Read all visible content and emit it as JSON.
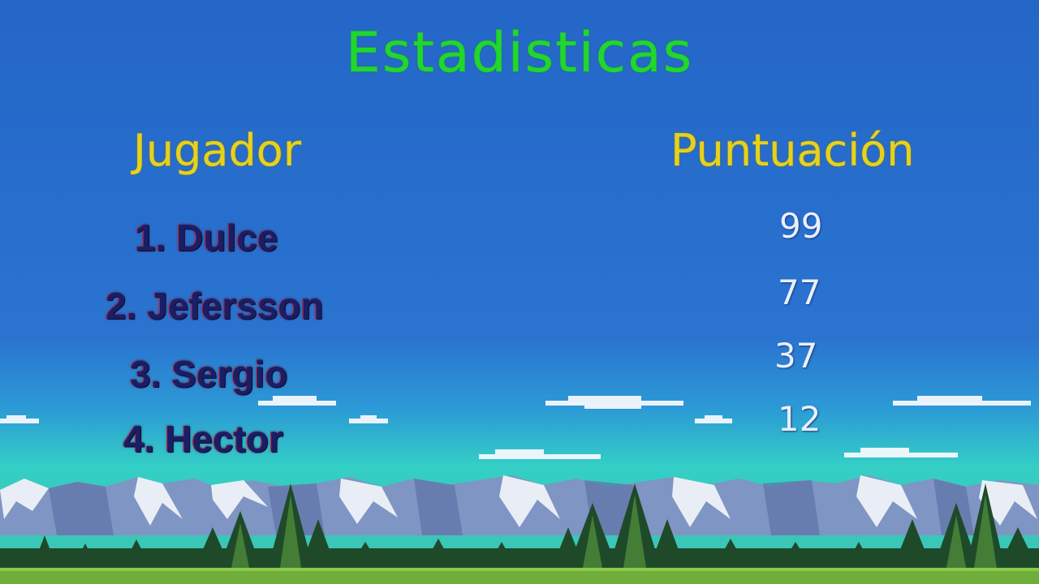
{
  "title": "Estadisticas",
  "headers": {
    "player": "Jugador",
    "score": "Puntuación"
  },
  "players": [
    "1. Dulce",
    "2. Jefersson",
    "3. Sergio",
    "4. Hector"
  ],
  "scores": [
    "99",
    "77",
    "37",
    "12"
  ],
  "colors": {
    "sky_top": "#2468c8",
    "sky_horizon": "#36d0c8",
    "title": "#1fd82c",
    "header": "#e6d21c",
    "player_text": "#1a1e66",
    "score_text": "#e8f0ff"
  }
}
